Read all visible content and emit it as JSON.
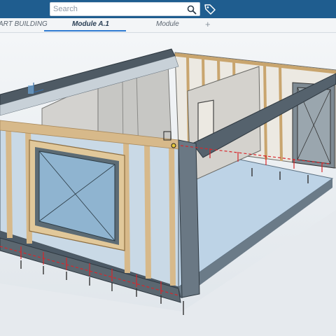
{
  "app": {
    "search": {
      "placeholder": "Search",
      "value": ""
    },
    "icons": {
      "search": "search-icon",
      "tag": "tag-icon"
    }
  },
  "tabs": [
    {
      "label": "ART BUILDING",
      "active": false
    },
    {
      "label": "Module A.1",
      "active": true
    },
    {
      "label": "Module",
      "active": false
    }
  ],
  "add_tab_label": "+",
  "colors": {
    "topbar": "#1f5d8f",
    "active_tab_underline": "#2f7bd1",
    "wood": "#d7b98a",
    "floor": "#bdd3e6",
    "glass": "#8fb4d0",
    "dimension_red": "#d8262b"
  }
}
